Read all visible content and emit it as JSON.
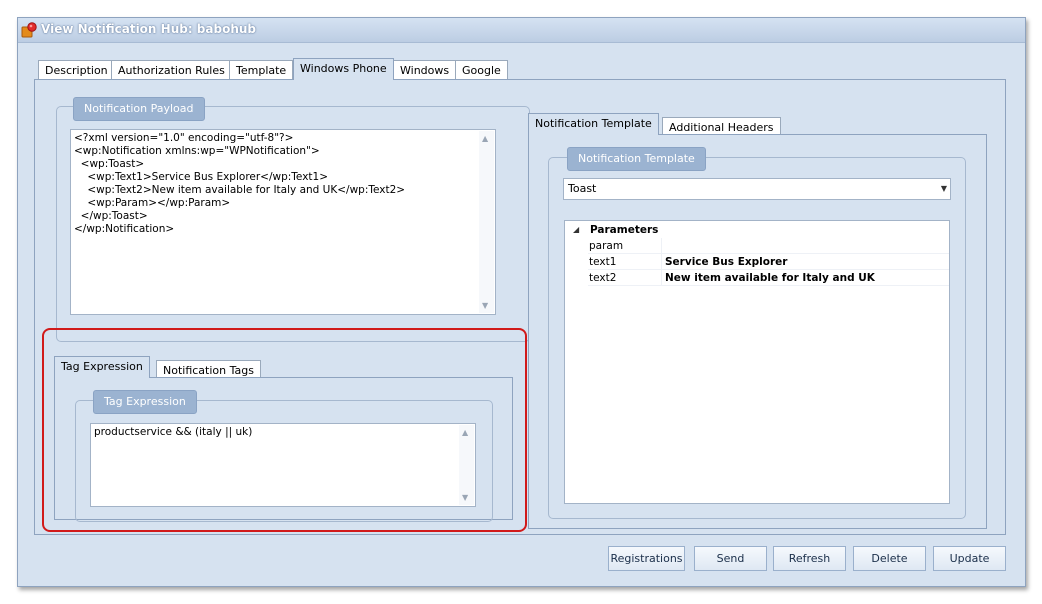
{
  "window": {
    "title": "View Notification Hub: babohub"
  },
  "main_tabs": [
    {
      "label": "Description"
    },
    {
      "label": "Authorization Rules"
    },
    {
      "label": "Template"
    },
    {
      "label": "Windows Phone"
    },
    {
      "label": "Windows"
    },
    {
      "label": "Google"
    }
  ],
  "payload": {
    "group_title": "Notification Payload",
    "lines": [
      "<?xml version=\"1.0\" encoding=\"utf-8\"?>",
      "<wp:Notification xmlns:wp=\"WPNotification\">",
      "  <wp:Toast>",
      "    <wp:Text1>Service Bus Explorer</wp:Text1>",
      "    <wp:Text2>New item available for Italy and UK</wp:Text2>",
      "    <wp:Param></wp:Param>",
      "  </wp:Toast>",
      "</wp:Notification>"
    ]
  },
  "tag_tabs": [
    {
      "label": "Tag Expression"
    },
    {
      "label": "Notification Tags"
    }
  ],
  "tag_expression": {
    "group_title": "Tag Expression",
    "value": "productservice && (italy || uk)"
  },
  "right_tabs": [
    {
      "label": "Notification Template"
    },
    {
      "label": "Additional Headers"
    }
  ],
  "template": {
    "group_title": "Notification Template",
    "selected": "Toast",
    "parameters_header": "Parameters",
    "parameters": [
      {
        "key": "param",
        "value": ""
      },
      {
        "key": "text1",
        "value": "Service Bus Explorer"
      },
      {
        "key": "text2",
        "value": "New item available for Italy and UK"
      }
    ]
  },
  "buttons": {
    "registrations": "Registrations",
    "send": "Send",
    "refresh": "Refresh",
    "delete": "Delete",
    "update": "Update"
  },
  "colors": {
    "highlight": "#d11a1a",
    "background": "#d6e2f0"
  }
}
